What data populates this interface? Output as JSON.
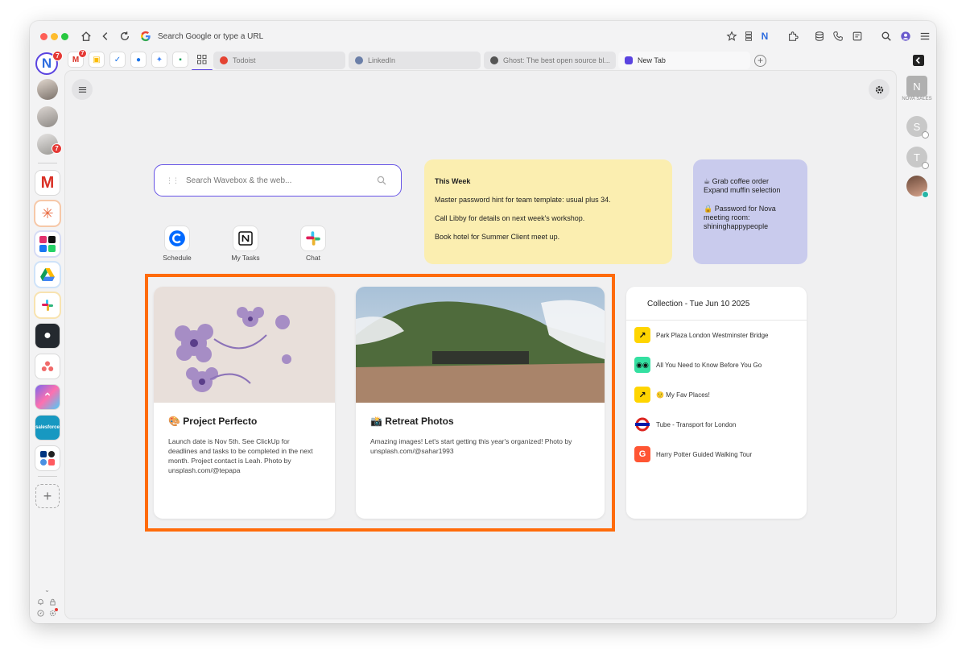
{
  "toolbar": {
    "address_placeholder": "Search Google or type a URL",
    "profile_initial": "N"
  },
  "tabs": [
    {
      "label": "Todoist",
      "color": "#e44332",
      "active": false
    },
    {
      "label": "LinkedIn",
      "color": "#6b7fa8",
      "active": false
    },
    {
      "label": "Ghost: The best open source bl...",
      "color": "#555555",
      "active": false
    },
    {
      "label": "New Tab",
      "color": "#5a43e0",
      "active": true
    }
  ],
  "workspace": {
    "initial": "N",
    "badge": "7",
    "gmail_badge": "7"
  },
  "sidebar": {
    "gmail_badge": "7"
  },
  "search": {
    "placeholder": "Search Wavebox & the web..."
  },
  "shortcuts": [
    {
      "label": "Schedule",
      "icon": "schedule-icon"
    },
    {
      "label": "My Tasks",
      "icon": "notion-icon"
    },
    {
      "label": "Chat",
      "icon": "slack-icon"
    }
  ],
  "notes": {
    "yellow": {
      "title": "This Week",
      "lines": [
        "Master password hint for team template: usual plus 34.",
        "Call Libby for details on next week's workshop.",
        "Book hotel for Summer Client meet up."
      ]
    },
    "purple": {
      "line1": "☕ Grab coffee order",
      "line2": "Expand muffin selection",
      "line3": "🔒 Password for Nova meeting room: shininghappypeople"
    }
  },
  "cards": [
    {
      "title": "🎨 Project Perfecto",
      "description": "Launch date is Nov 5th. See ClickUp for deadlines and tasks to be completed in the next month. Project contact is Leah. Photo by unsplash.com/@tepapa"
    },
    {
      "title": "📸 Retreat Photos",
      "description": "Amazing images! Let's start getting this year's organized! Photo by unsplash.com/@sahar1993"
    }
  ],
  "collection": {
    "title": "Collection - Tue Jun 10 2025",
    "items": [
      {
        "label": "Park Plaza London Westminster Bridge",
        "icon": "arrow-icon",
        "color": "#ffd500"
      },
      {
        "label": "All You Need to Know Before You Go",
        "icon": "tripadvisor-icon",
        "color": "#34e0a1"
      },
      {
        "label": "🙂 My Fav Places!",
        "icon": "arrow-icon",
        "color": "#ffd500"
      },
      {
        "label": "Tube - Transport for London",
        "icon": "tfl-icon",
        "color": "#0019a8"
      },
      {
        "label": "Harry Potter Guided Walking Tour",
        "icon": "getyourguide-icon",
        "color": "#ff5533"
      }
    ]
  },
  "right_sidebar": {
    "workspace_initial": "N",
    "workspace_label": "NOVA SALES",
    "avatars": [
      "S",
      "T"
    ]
  }
}
